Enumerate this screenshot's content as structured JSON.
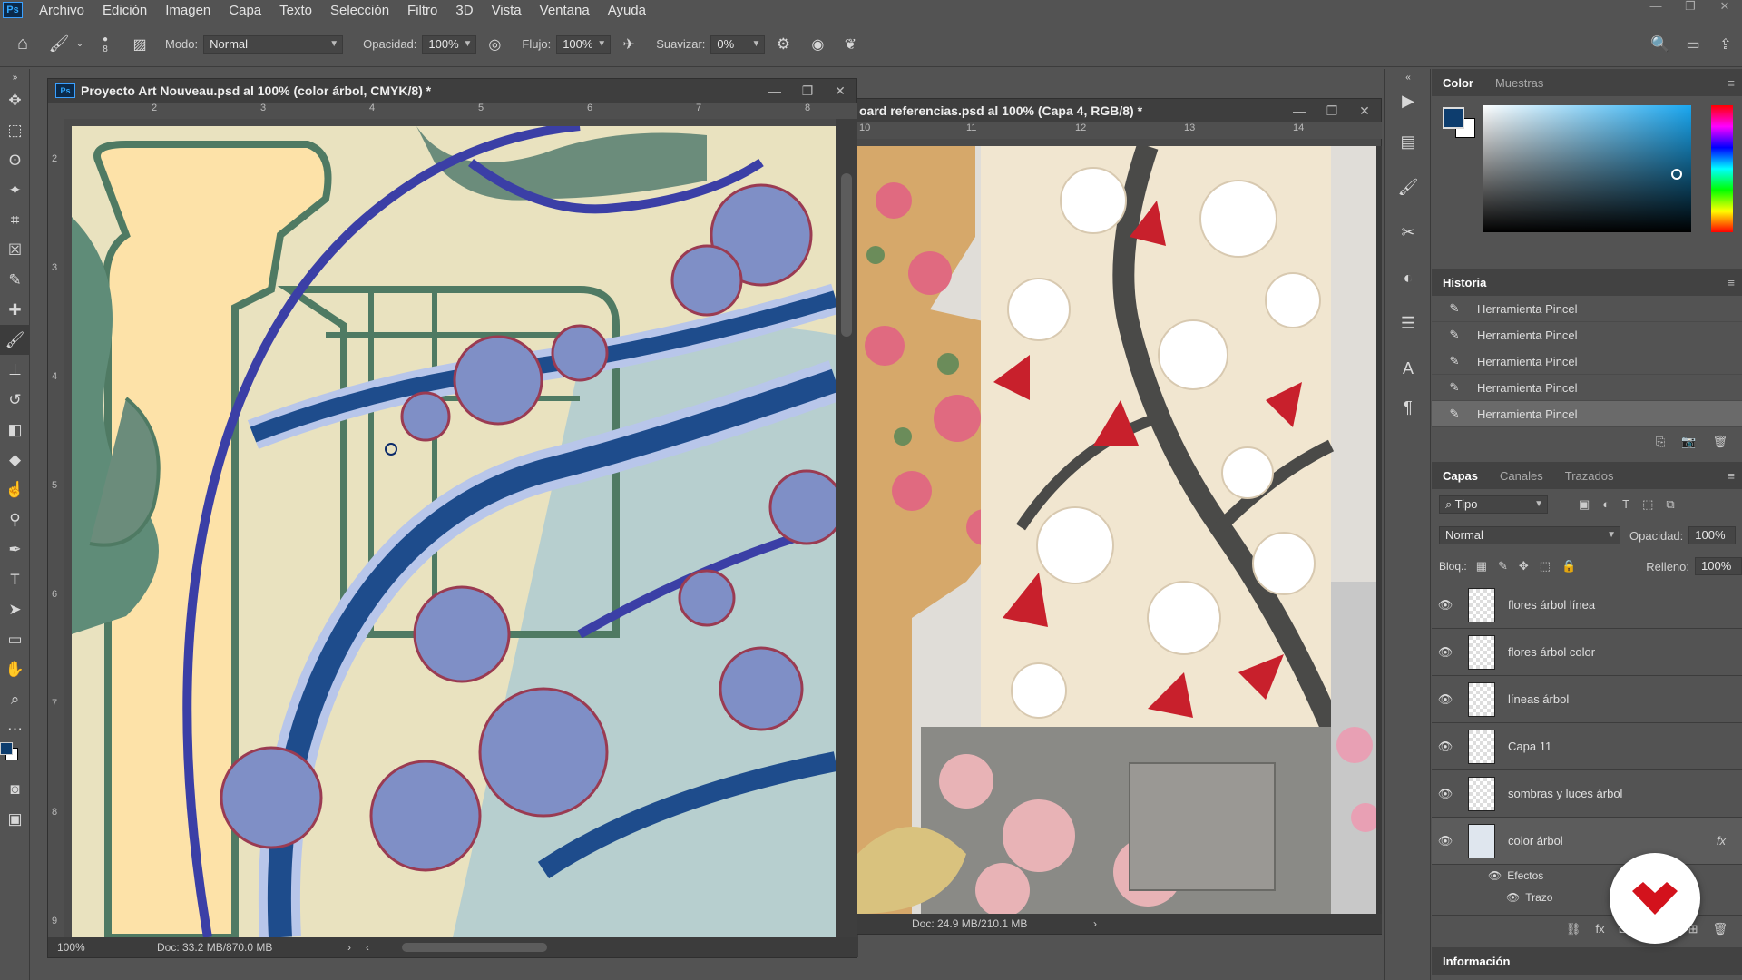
{
  "menu": [
    "Archivo",
    "Edición",
    "Imagen",
    "Capa",
    "Texto",
    "Selección",
    "Filtro",
    "3D",
    "Vista",
    "Ventana",
    "Ayuda"
  ],
  "app_logo": "Ps",
  "options": {
    "brush_size": "8",
    "mode_label": "Modo:",
    "mode_value": "Normal",
    "opacity_label": "Opacidad:",
    "opacity_value": "100%",
    "flow_label": "Flujo:",
    "flow_value": "100%",
    "smooth_label": "Suavizar:",
    "smooth_value": "0%"
  },
  "doc1": {
    "title": "Proyecto Art Nouveau.psd al 100% (color árbol, CMYK/8) *",
    "zoom": "100%",
    "status": "Doc: 33.2 MB/870.0 MB",
    "h_ruler": [
      "2",
      "3",
      "4",
      "5",
      "6",
      "7",
      "8"
    ],
    "v_ruler": [
      "2",
      "3",
      "4",
      "5",
      "6",
      "7",
      "8",
      "9"
    ]
  },
  "doc2": {
    "title": "oard referencias.psd al 100% (Capa 4, RGB/8) *",
    "status": "Doc: 24.9 MB/210.1 MB",
    "h_ruler": [
      "10",
      "11",
      "12",
      "13",
      "14"
    ]
  },
  "color_panel": {
    "tabs": [
      "Color",
      "Muestras"
    ],
    "fg": "#0d3d6e",
    "bg": "#ffffff"
  },
  "history": {
    "title": "Historia",
    "items": [
      "Herramienta Pincel",
      "Herramienta Pincel",
      "Herramienta Pincel",
      "Herramienta Pincel",
      "Herramienta Pincel"
    ]
  },
  "layers": {
    "tabs": [
      "Capas",
      "Canales",
      "Trazados"
    ],
    "filter": "Tipo",
    "blend": "Normal",
    "opacity_label": "Opacidad:",
    "opacity": "100%",
    "lock_label": "Bloq.:",
    "fill_label": "Relleno:",
    "fill": "100%",
    "items": [
      "flores árbol línea",
      "flores árbol color",
      "líneas árbol",
      "Capa 11",
      "sombras y luces árbol",
      "color árbol"
    ],
    "effects_label": "Efectos",
    "stroke_label": "Trazo",
    "fx": "fx"
  },
  "info_panel": "Información"
}
